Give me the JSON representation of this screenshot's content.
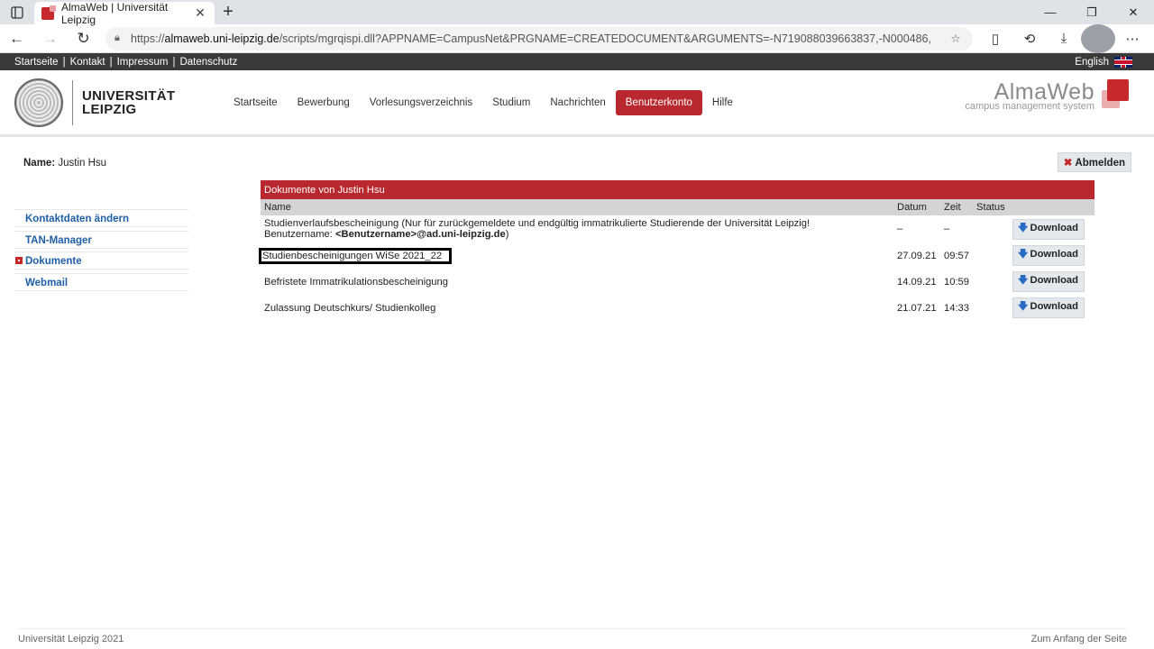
{
  "browser": {
    "tab_title": "AlmaWeb | Universität Leipzig",
    "url_prefix": "https://",
    "url_domain": "almaweb.uni-leipzig.de",
    "url_rest": "/scripts/mgrqispi.dll?APPNAME=CampusNet&PRGNAME=CREATEDOCUMENT&ARGUMENTS=-N719088039663837,-N000486,"
  },
  "topstrip": {
    "links": [
      "Startseite",
      "Kontakt",
      "Impressum",
      "Datenschutz"
    ],
    "separator": "|",
    "language": "English"
  },
  "header": {
    "uni_line1": "UNIVERSITÄT",
    "uni_line2": "LEIPZIG",
    "nav": [
      {
        "label": "Startseite"
      },
      {
        "label": "Bewerbung"
      },
      {
        "label": "Vorlesungsverzeichnis"
      },
      {
        "label": "Studium"
      },
      {
        "label": "Nachrichten"
      },
      {
        "label": "Benutzerkonto",
        "active": true
      },
      {
        "label": "Hilfe"
      }
    ],
    "brand": "AlmaWeb",
    "brand_tagline": "campus management system"
  },
  "user": {
    "name_label": "Name:",
    "name_value": "Justin Hsu",
    "logout_label": "Abmelden"
  },
  "sidebar": {
    "items": [
      {
        "label": "Kontaktdaten ändern"
      },
      {
        "label": "TAN-Manager"
      },
      {
        "label": "Dokumente",
        "active": true
      },
      {
        "label": "Webmail"
      }
    ]
  },
  "documents": {
    "caption": "Dokumente von Justin Hsu",
    "columns": [
      "Name",
      "Datum",
      "Zeit",
      "Status"
    ],
    "download_label": "Download",
    "rows": [
      {
        "name": "Studienverlaufsbescheinigung (Nur für zurückgemeldete und endgültig immatrikulierte Studierende der Universität Leipzig!",
        "name_line2_prefix": "Benutzername: ",
        "name_line2_bold": "<Benutzername>@ad.uni-leipzig.de",
        "name_line2_suffix": ")",
        "date": "–",
        "time": "–"
      },
      {
        "name": "Studienbescheinigungen WiSe 2021_22",
        "date": "27.09.21",
        "time": "09:57",
        "highlighted": true
      },
      {
        "name": "Befristete Immatrikulationsbescheinigung",
        "date": "14.09.21",
        "time": "10:59"
      },
      {
        "name": "Zulassung Deutschkurs/ Studienkolleg",
        "date": "21.07.21",
        "time": "14:33"
      }
    ]
  },
  "footer": {
    "copyright": "Universität Leipzig 2021",
    "to_top": "Zum Anfang der Seite"
  },
  "colors": {
    "brand_red": "#b8282e",
    "link_blue": "#1f5fa8",
    "topstrip_bg": "#3a3a3a"
  }
}
